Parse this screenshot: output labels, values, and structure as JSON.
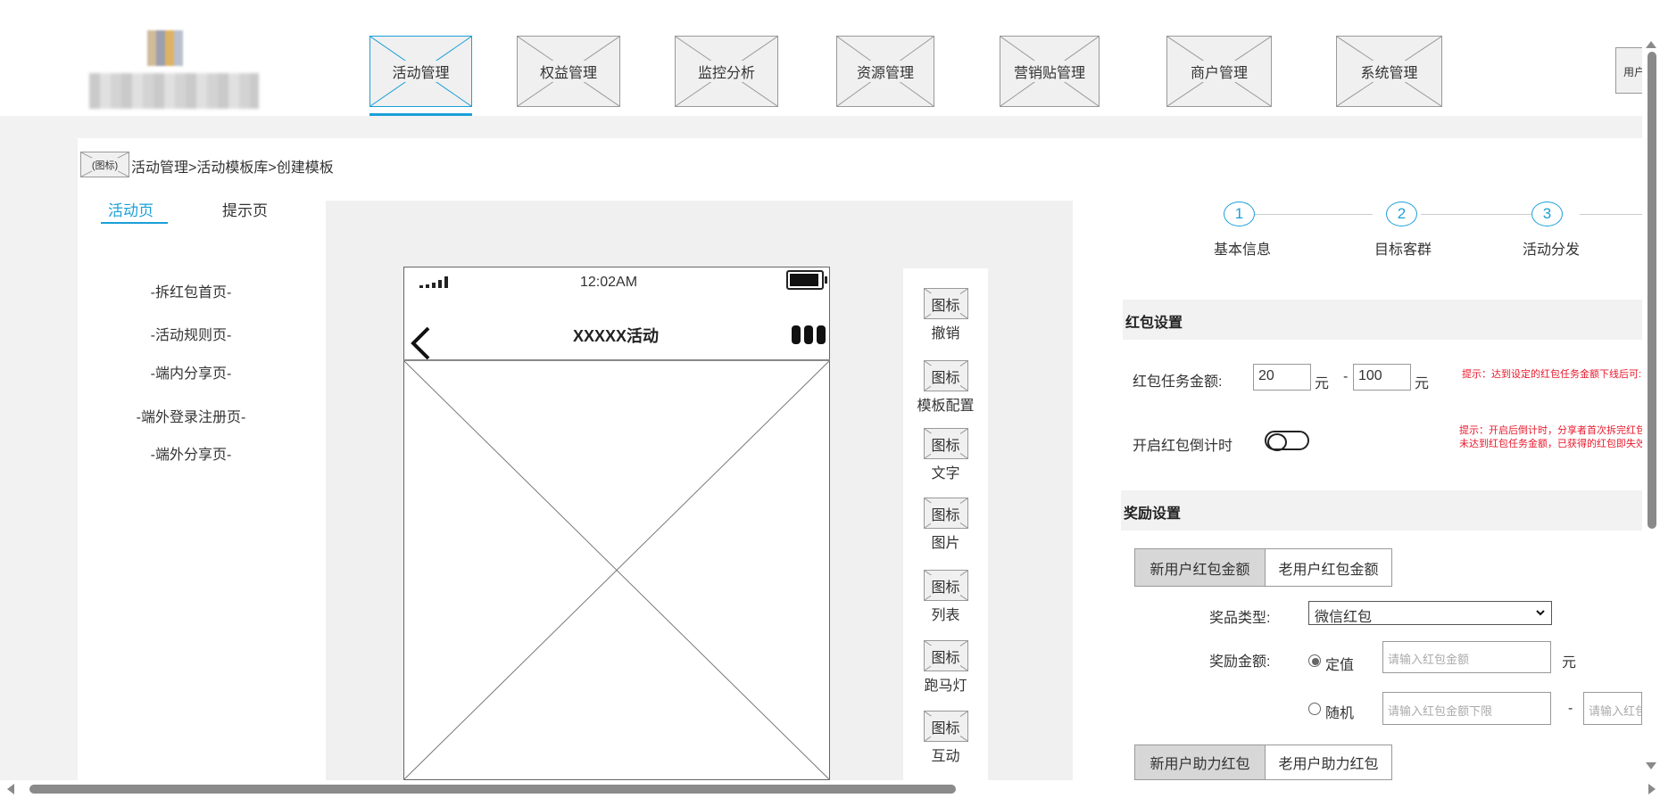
{
  "nav": {
    "items": [
      "活动管理",
      "权益管理",
      "监控分析",
      "资源管理",
      "营销贴管理",
      "商户管理",
      "系统管理"
    ],
    "active": "活动管理",
    "user_label": "用户"
  },
  "breadcrumb": {
    "icon_label": "(图标)",
    "path": "活动管理>活动模板库>创建模板"
  },
  "left_panel": {
    "tabs": [
      "活动页",
      "提示页"
    ],
    "active_tab": "活动页",
    "pages": [
      "-拆红包首页-",
      "-活动规则页-",
      "-端内分享页-",
      "-端外登录注册页-",
      "-端外分享页-"
    ]
  },
  "phone": {
    "time": "12:02AM",
    "title": "XXXXX活动"
  },
  "toolbox": {
    "icon_label": "图标",
    "tools": [
      "撤销",
      "模板配置",
      "文字",
      "图片",
      "列表",
      "跑马灯",
      "互动"
    ]
  },
  "steps": [
    {
      "num": "1",
      "label": "基本信息"
    },
    {
      "num": "2",
      "label": "目标客群"
    },
    {
      "num": "3",
      "label": "活动分发"
    }
  ],
  "redpacket": {
    "section_title": "红包设置",
    "amount_label": "红包任务金额:",
    "min_value": "20",
    "max_value": "100",
    "unit": "元",
    "dash": "-",
    "amount_hint": "提示：达到设定的红包任务金额下线后可:",
    "countdown_label": "开启红包倒计时",
    "countdown_hint_1": "提示：开启后倒计时，分享者首次拆完红包",
    "countdown_hint_2": "未达到红包任务金额，已获得的红包即失效"
  },
  "reward": {
    "section_title": "奖励设置",
    "tabs": [
      "新用户红包金额",
      "老用户红包金额"
    ],
    "active_tab": "新用户红包金额",
    "prize_type_label": "奖品类型:",
    "prize_type_value": "微信红包",
    "amount_label": "奖励金额:",
    "fixed_label": "定值",
    "fixed_placeholder": "请输入红包金额",
    "unit": "元",
    "random_label": "随机",
    "random_min_placeholder": "请输入红包金额下限",
    "dash": "-",
    "random_max_placeholder": "请输入红包",
    "assist_tabs": [
      "新用户助力红包",
      "老用户助力红包"
    ],
    "assist_active_tab": "新用户助力红包"
  },
  "colors": {
    "accent": "#1ba0d8",
    "hint": "#e8192c",
    "wireframe_fill": "#f0f0f0",
    "background": "#f2f2f2"
  }
}
